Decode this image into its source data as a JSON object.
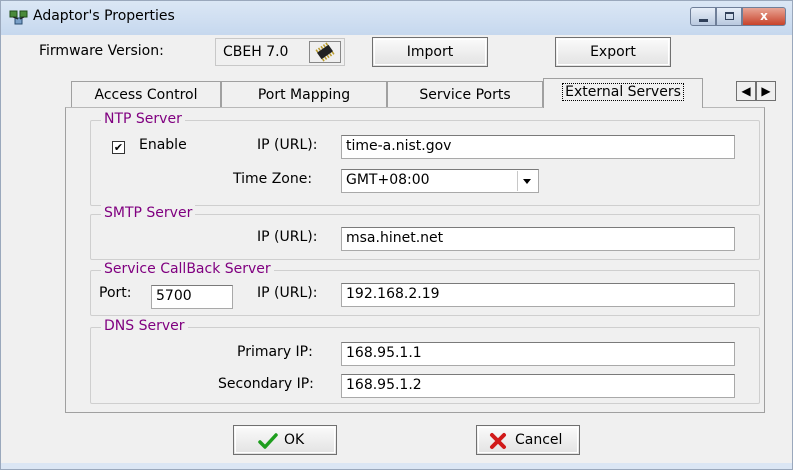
{
  "window": {
    "title": "Adaptor's Properties",
    "close_glyph": "x",
    "accent_color": "#800080"
  },
  "firmware": {
    "label": "Firmware Version:",
    "value": "CBEH 7.0",
    "chip_icon": "chip-icon"
  },
  "toolbar": {
    "import_label": "Import",
    "export_label": "Export"
  },
  "tabs": [
    {
      "label": "Access Control",
      "active": false
    },
    {
      "label": "Port Mapping",
      "active": false
    },
    {
      "label": "Service Ports",
      "active": false
    },
    {
      "label": "External Servers",
      "active": true
    }
  ],
  "tab_scroll": {
    "left": "◀",
    "right": "▶"
  },
  "ntp": {
    "title": "NTP Server",
    "enable_label": "Enable",
    "enable_checked": true,
    "check_glyph": "✔",
    "ip_label": "IP (URL):",
    "ip_value": "time-a.nist.gov",
    "timezone_label": "Time Zone:",
    "timezone_value": "GMT+08:00"
  },
  "smtp": {
    "title": "SMTP Server",
    "ip_label": "IP (URL):",
    "ip_value": "msa.hinet.net"
  },
  "callback": {
    "title": "Service CallBack Server",
    "port_label": "Port:",
    "port_value": "5700",
    "ip_label": "IP (URL):",
    "ip_value": "192.168.2.19"
  },
  "dns": {
    "title": "DNS Server",
    "primary_label": "Primary IP:",
    "primary_value": "168.95.1.1",
    "secondary_label": "Secondary IP:",
    "secondary_value": "168.95.1.2"
  },
  "footer": {
    "ok_label": "OK",
    "cancel_label": "Cancel"
  }
}
